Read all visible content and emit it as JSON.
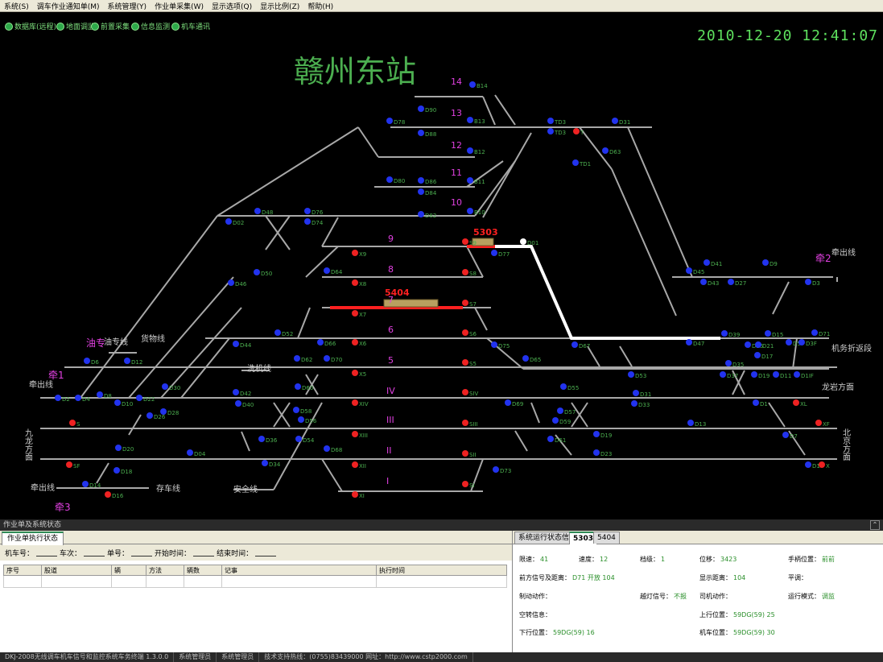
{
  "menu": [
    "系统(S)",
    "调车作业通知单(M)",
    "系统管理(Y)",
    "作业单采集(W)",
    "显示选项(Q)",
    "显示比例(Z)",
    "帮助(H)"
  ],
  "toolbar": [
    "数据库(远程)",
    "地面调监",
    "前置采集",
    "信息监测",
    "机车通讯"
  ],
  "clock": "2010-12-20 12:41:07",
  "station_name": "赣州东站",
  "track_labels": [
    "14",
    "13",
    "12",
    "11",
    "10",
    "9",
    "8",
    "7",
    "6",
    "5",
    "IV",
    "III",
    "II",
    "I"
  ],
  "trains": [
    {
      "id": "5303",
      "color": "#ff2020"
    },
    {
      "id": "5404",
      "color": "#ff2020"
    }
  ],
  "signals": [
    "B14",
    "D90",
    "D78",
    "B13",
    "D88",
    "B12",
    "D80",
    "D86",
    "B11",
    "D84",
    "B10",
    "D82",
    "D76",
    "D48",
    "D02",
    "D74",
    "TD3",
    "D31",
    "TD3",
    "T",
    "D63",
    "TD1",
    "D01",
    "S9",
    "D77",
    "X9",
    "D64",
    "X8",
    "S8",
    "D50",
    "D46",
    "5404",
    "X7",
    "S7",
    "X6",
    "S6",
    "D75",
    "D65",
    "D67",
    "D52",
    "D44",
    "D62",
    "D66",
    "D70",
    "X5",
    "S5",
    "D53",
    "D60",
    "D42",
    "D40",
    "D30",
    "D28",
    "XIV",
    "SIV",
    "D69",
    "D55",
    "D57",
    "D59",
    "D31",
    "D33",
    "D26",
    "D58",
    "D56",
    "XIII",
    "SIII",
    "D61",
    "D19",
    "D13",
    "D36",
    "D54",
    "D68",
    "D20",
    "D18",
    "D04",
    "D34",
    "XII",
    "SII",
    "D23",
    "D73",
    "D14",
    "D16",
    "XI",
    "SI",
    "D45",
    "D41",
    "D43",
    "D27",
    "D9",
    "D3",
    "D47",
    "D39",
    "D15",
    "D71",
    "D25",
    "D17",
    "D21",
    "D5",
    "D3F",
    "D35",
    "D37",
    "D19",
    "D11",
    "D1IF",
    "D1",
    "D7",
    "XL",
    "XF",
    "X",
    "D1",
    "D2",
    "D4",
    "D6",
    "D8",
    "D10",
    "D12",
    "D22",
    "S",
    "SF"
  ],
  "text_labels": {
    "qian1": "牵1",
    "qian2": "牵2",
    "qian3": "牵3",
    "qianchuxian_left": "牵出线",
    "qianchuxian_right": "牵出线",
    "qianchuxian_bottom": "牵出线",
    "youzhuan": "油专",
    "youzhuanxian": "油专线",
    "huowuxian": "货物线",
    "jijixian": "洗机线",
    "anquanxian": "安全线",
    "cunchexian": "存车线",
    "longyan": "龙岩方面",
    "jiwu": "机务折返段",
    "jiulong": "九龙方面",
    "beijing": "北京方面"
  },
  "bottom_panel": {
    "title": "作业单及系统状态",
    "left_tab": "作业单执行状态",
    "filters": [
      "机车号：",
      "车次：",
      "单号：",
      "开始时间：",
      "结束时间："
    ],
    "columns": [
      "序号",
      "股道",
      "辆",
      "方法",
      "辆数",
      "记事",
      "执行时间"
    ]
  },
  "right_tabs": [
    "系统运行状态信息",
    "5303",
    "5404"
  ],
  "status_info": {
    "speed_limit": {
      "label": "限速：",
      "value": "41"
    },
    "speed": {
      "label": "速度：",
      "value": "12"
    },
    "gear": {
      "label": "档级：",
      "value": "1"
    },
    "position": {
      "label": "位移：",
      "value": "3423"
    },
    "handle": {
      "label": "手柄位置：",
      "value": "前前"
    },
    "front_signal": {
      "label": "前方信号及距离：",
      "value": "D71  开放  104"
    },
    "display_dist": {
      "label": "显示距离：",
      "value": "104"
    },
    "flat": {
      "label": "平调：",
      "value": ""
    },
    "loco_action": {
      "label": "制动动作：",
      "value": ""
    },
    "pass_signal": {
      "label": "越灯信号：",
      "value": "不报"
    },
    "driver_action": {
      "label": "司机动作：",
      "value": ""
    },
    "run_mode": {
      "label": "运行模式：",
      "value": "调监"
    },
    "hollow": {
      "label": "空转信息：",
      "value": ""
    },
    "up_pos": {
      "label": "上行位置：",
      "value": "59DG(59)  25"
    },
    "down_pos": {
      "label": "下行位置：",
      "value": "59DG(59)  16"
    },
    "loco_pos": {
      "label": "机车位置：",
      "value": "59DG(59)  30"
    }
  },
  "statusbar": [
    "DKJ-2008无线调车机车信号和监控系统车务终端 1.3.0.0",
    "系统管理员",
    "系统管理员",
    "技术支持热线：(0755)83439000  网址：http://www.cstp2000.com"
  ]
}
